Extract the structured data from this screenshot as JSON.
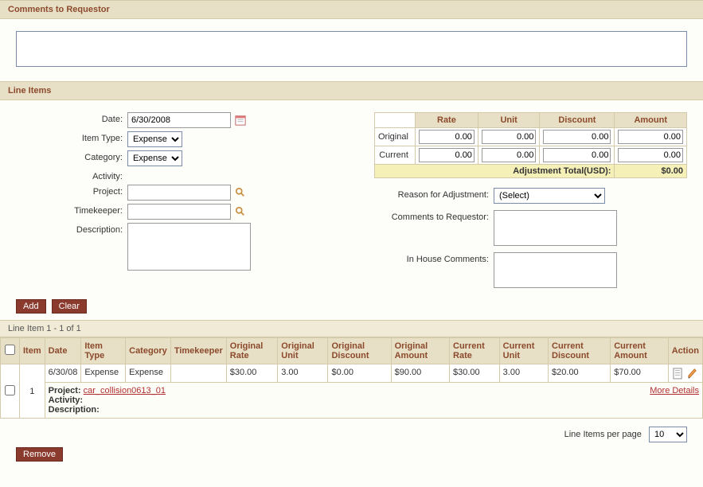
{
  "comments": {
    "header": "Comments to Requestor",
    "value": ""
  },
  "lineItems": {
    "header": "Line Items",
    "form": {
      "labels": {
        "date": "Date:",
        "itemType": "Item Type:",
        "category": "Category:",
        "activity": "Activity:",
        "project": "Project:",
        "timekeeper": "Timekeeper:",
        "description": "Description:"
      },
      "values": {
        "date": "6/30/2008",
        "itemType": "Expense",
        "category": "Expense",
        "activity": "",
        "project": "",
        "timekeeper": "",
        "description": ""
      }
    },
    "rateTable": {
      "headers": {
        "rate": "Rate",
        "unit": "Unit",
        "discount": "Discount",
        "amount": "Amount"
      },
      "rows": {
        "original": {
          "label": "Original",
          "rate": "0.00",
          "unit": "0.00",
          "discount": "0.00",
          "amount": "0.00"
        },
        "current": {
          "label": "Current",
          "rate": "0.00",
          "unit": "0.00",
          "discount": "0.00",
          "amount": "0.00"
        }
      },
      "adjTotalLabel": "Adjustment Total(USD):",
      "adjTotalValue": "$0.00"
    },
    "adjustment": {
      "labels": {
        "reason": "Reason for Adjustment:",
        "commentsReq": "Comments to Requestor:",
        "inHouse": "In House Comments:"
      },
      "reasonSelected": "(Select)",
      "commentsReq": "",
      "inHouse": ""
    },
    "buttons": {
      "add": "Add",
      "clear": "Clear",
      "remove": "Remove"
    },
    "tableInfo": "Line Item 1 - 1 of 1",
    "columns": {
      "item": "Item",
      "date": "Date",
      "itemType": "Item Type",
      "category": "Category",
      "timekeeper": "Timekeeper",
      "origRate": "Original Rate",
      "origUnit": "Original Unit",
      "origDisc": "Original Discount",
      "origAmt": "Original Amount",
      "curRate": "Current Rate",
      "curUnit": "Current Unit",
      "curDisc": "Current Discount",
      "curAmt": "Current Amount",
      "action": "Action"
    },
    "row": {
      "item": "1",
      "date": "6/30/08",
      "itemType": "Expense",
      "category": "Expense",
      "timekeeper": "",
      "origRate": "$30.00",
      "origUnit": "3.00",
      "origDisc": "$0.00",
      "origAmt": "$90.00",
      "curRate": "$30.00",
      "curUnit": "3.00",
      "curDisc": "$20.00",
      "curAmt": "$70.00"
    },
    "detail": {
      "projectLabel": "Project:",
      "projectValue": "car_collision0613_01",
      "activityLabel": "Activity:",
      "activityValue": "",
      "descriptionLabel": "Description:",
      "descriptionValue": "",
      "moreDetails": "More Details"
    },
    "pager": {
      "label": "Line Items per page",
      "selected": "10"
    }
  }
}
